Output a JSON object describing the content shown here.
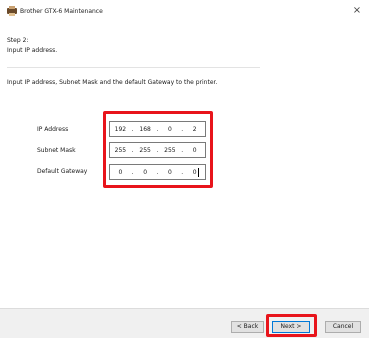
{
  "window": {
    "title": "Brother GTX-6 Maintenance",
    "close_glyph": "×",
    "icon": "printer-app-icon"
  },
  "step": {
    "title": "Step 2:",
    "subtitle": "Input IP address."
  },
  "instruction": "Input IP address, Subnet Mask and the default Gateway to the printer.",
  "fields": {
    "ip_address": {
      "label": "IP Address",
      "octets": [
        "192",
        "168",
        "0",
        "2"
      ]
    },
    "subnet_mask": {
      "label": "Subnet Mask",
      "octets": [
        "255",
        "255",
        "255",
        "0"
      ]
    },
    "default_gateway": {
      "label": "Default Gateway",
      "octets": [
        "0",
        "0",
        "0",
        "0"
      ]
    },
    "separator": "."
  },
  "buttons": {
    "back": "< Back",
    "next": "Next >",
    "cancel": "Cancel"
  },
  "colors": {
    "highlight": "#e8141b",
    "focus_border": "#0078d7"
  }
}
